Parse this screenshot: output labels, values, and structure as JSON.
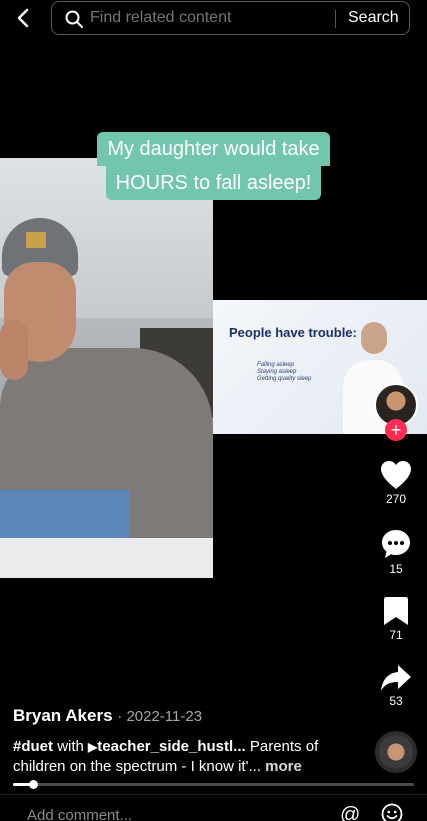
{
  "search": {
    "placeholder": "Find related content",
    "submit_label": "Search"
  },
  "caption": {
    "line1": "My daughter would take",
    "line2": "HOURS to fall asleep!"
  },
  "duet_slide": {
    "title": "People have trouble:",
    "bullets": [
      "Falling asleep",
      "Staying asleep",
      "Getting quality sleep"
    ]
  },
  "actions": {
    "likes": "270",
    "comments": "15",
    "saves": "71",
    "shares": "53"
  },
  "post": {
    "author": "Bryan Akers",
    "date": "· 2022-11-23",
    "hashtag": "#duet",
    "with_text": "with",
    "duet_user": "teacher_side_hustl...",
    "description": "Parents of children on the spectrum - I know it'...",
    "more_label": "more"
  },
  "progress": {
    "played_fraction": 0.05
  },
  "comment": {
    "placeholder": "Add comment..."
  },
  "colors": {
    "caption_bg": "#72c6ad",
    "follow_red": "#fe2c55"
  }
}
